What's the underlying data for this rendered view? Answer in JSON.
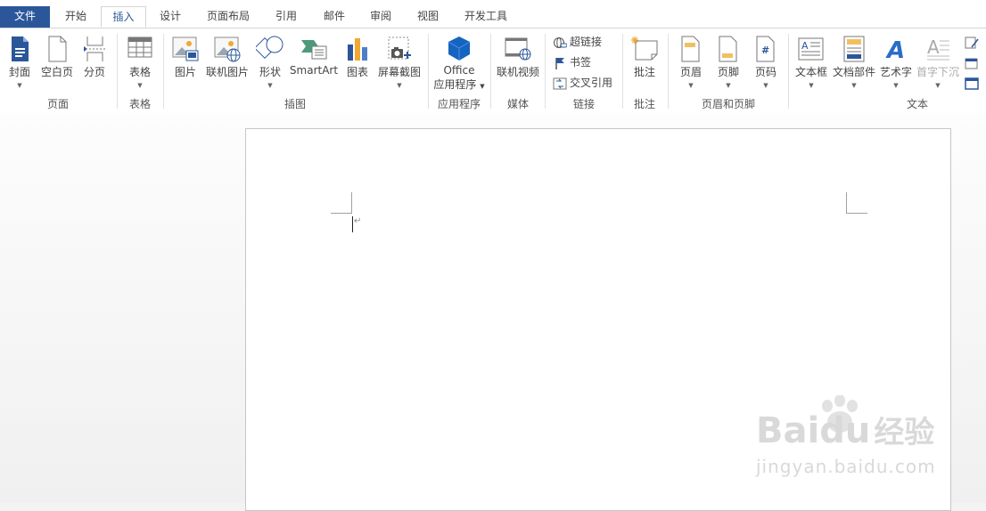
{
  "tabs": {
    "file": "文件",
    "home": "开始",
    "insert": "插入",
    "design": "设计",
    "layout": "页面布局",
    "references": "引用",
    "mailings": "邮件",
    "review": "审阅",
    "view": "视图",
    "developer": "开发工具"
  },
  "ribbon": {
    "pages": {
      "cover": "封面",
      "blank": "空白页",
      "break": "分页",
      "group": "页面"
    },
    "tables": {
      "table": "表格",
      "group": "表格"
    },
    "illustrations": {
      "picture": "图片",
      "online_picture": "联机图片",
      "shapes": "形状",
      "smartart": "SmartArt",
      "chart": "图表",
      "screenshot": "屏幕截图",
      "group": "插图"
    },
    "apps": {
      "office_line1": "Office",
      "office_line2": "应用程序",
      "group": "应用程序"
    },
    "media": {
      "online_video": "联机视频",
      "group": "媒体"
    },
    "links": {
      "hyperlink": "超链接",
      "bookmark": "书签",
      "crossref": "交叉引用",
      "group": "链接"
    },
    "comments": {
      "comment": "批注",
      "group": "批注"
    },
    "header_footer": {
      "header": "页眉",
      "footer": "页脚",
      "page_number": "页码",
      "group": "页眉和页脚"
    },
    "text": {
      "textbox": "文本框",
      "quickparts": "文档部件",
      "wordart": "艺术字",
      "dropcap": "首字下沉",
      "group": "文本"
    }
  },
  "colors": {
    "accent": "#2b579a",
    "icon_blue": "#2b579a",
    "icon_orange": "#f0a830"
  },
  "watermark": {
    "brand": "Bai",
    "brand2": "du",
    "cn": "经验",
    "url": "jingyan.baidu.com"
  }
}
